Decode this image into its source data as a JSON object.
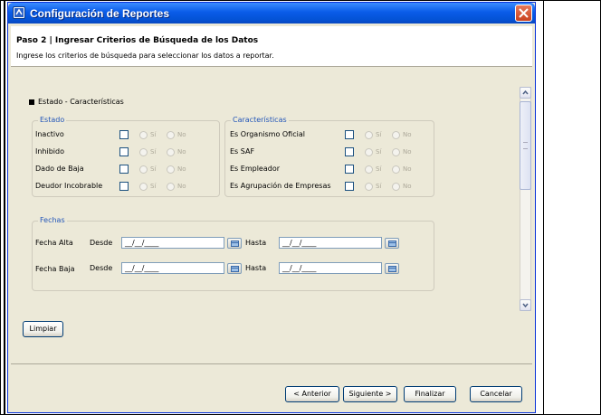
{
  "window": {
    "title": "Configuración de Reportes"
  },
  "header": {
    "step_title": "Paso 2 | Ingresar Criterios de Búsqueda de los Datos",
    "step_description": "Ingrese los criterios de búsqueda para seleccionar los datos a reportar."
  },
  "section": {
    "title": "Estado - Características"
  },
  "estado": {
    "legend": "Estado",
    "rows": [
      {
        "label": "Inactivo",
        "yes": "Sí",
        "no": "No"
      },
      {
        "label": "Inhibido",
        "yes": "Sí",
        "no": "No"
      },
      {
        "label": "Dado de Baja",
        "yes": "Sí",
        "no": "No"
      },
      {
        "label": "Deudor Incobrable",
        "yes": "Sí",
        "no": "No"
      }
    ]
  },
  "caracteristicas": {
    "legend": "Características",
    "rows": [
      {
        "label": "Es Organismo Oficial",
        "yes": "Sí",
        "no": "No"
      },
      {
        "label": "Es SAF",
        "yes": "Sí",
        "no": "No"
      },
      {
        "label": "Es Empleador",
        "yes": "Sí",
        "no": "No"
      },
      {
        "label": "Es Agrupación de Empresas",
        "yes": "Sí",
        "no": "No"
      }
    ]
  },
  "fechas": {
    "legend": "Fechas",
    "desde_label": "Desde",
    "hasta_label": "Hasta",
    "date_placeholder": "__/__/____",
    "rows": [
      {
        "label": "Fecha Alta",
        "desde": "__/__/____",
        "hasta": "__/__/____"
      },
      {
        "label": "Fecha Baja",
        "desde": "__/__/____",
        "hasta": "__/__/____"
      }
    ]
  },
  "buttons": {
    "limpiar": "Limpiar",
    "anterior": "< Anterior",
    "siguiente": "Siguiente >",
    "finalizar": "Finalizar",
    "cancelar": "Cancelar"
  },
  "icons": [
    "app-icon",
    "close-icon",
    "collapse-toggle-icon",
    "calendar-icon",
    "scroll-up-icon",
    "scroll-down-icon"
  ],
  "colors": {
    "titlebar": "#0a5ce8",
    "legend_text": "#2356b9",
    "window_bg": "#ece9d8",
    "close_button": "#c9411e"
  }
}
